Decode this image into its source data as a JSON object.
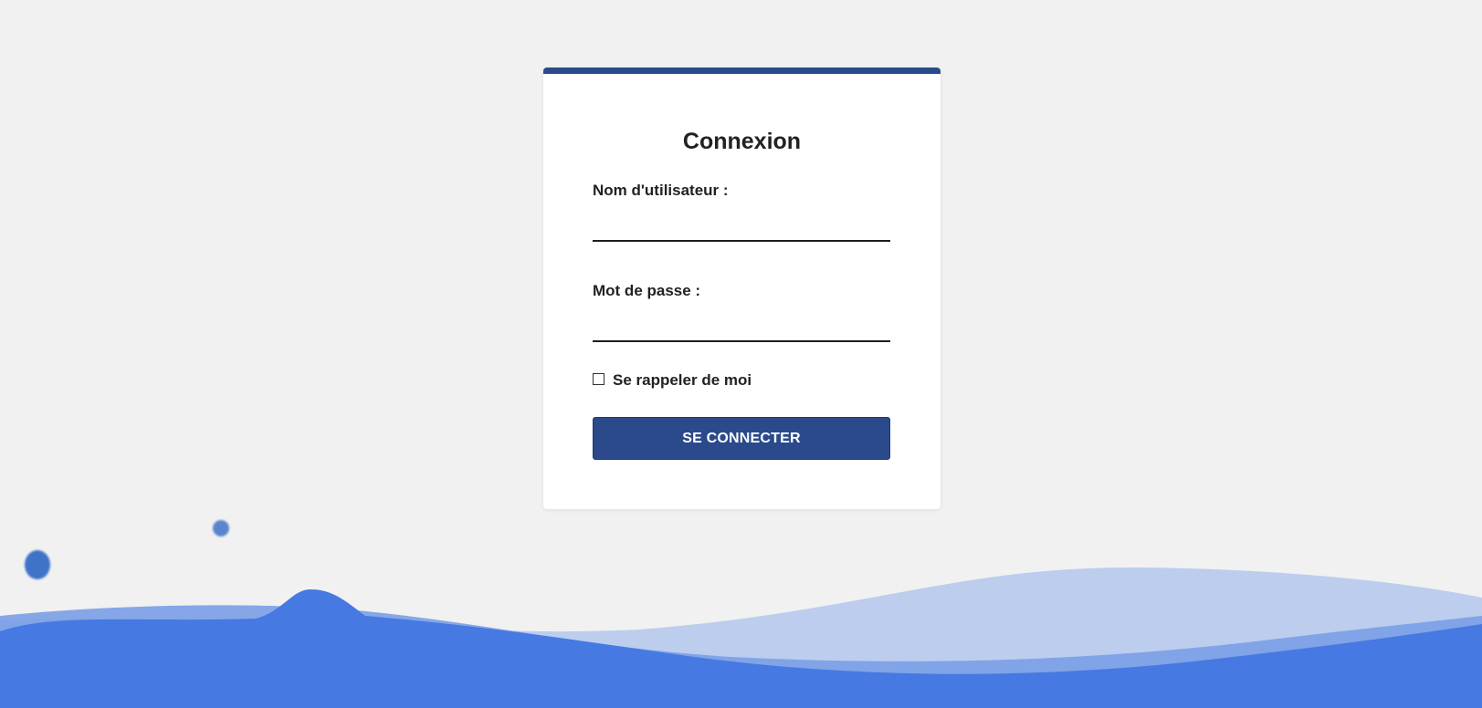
{
  "login": {
    "title": "Connexion",
    "username_label": "Nom d'utilisateur :",
    "username_value": "",
    "password_label": "Mot de passe :",
    "password_value": "",
    "remember_label": "Se rappeler de moi",
    "remember_checked": false,
    "submit_label": "SE CONNECTER"
  },
  "colors": {
    "background": "#f1f1f1",
    "accent": "#2a4a8b",
    "wave_light": "#bccdee",
    "wave_mid": "#7a9fe6",
    "wave_dark": "#4679e2"
  }
}
